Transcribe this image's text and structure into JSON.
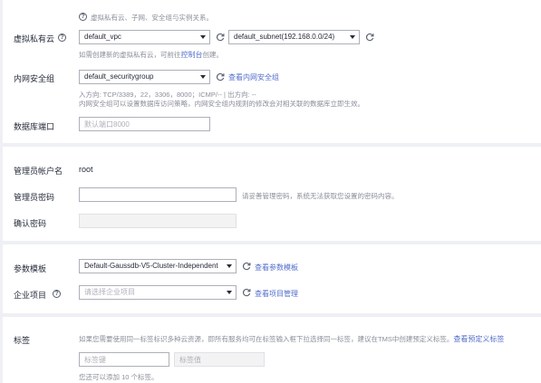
{
  "network": {
    "help_text": "虚拟私有云、子网、安全组与实例关系。",
    "vpc_label": "虚拟私有云",
    "vpc_value": "default_vpc",
    "subnet_value": "default_subnet(192.168.0.0/24)",
    "vpc_hint_prefix": "如需创建新的虚拟私有云，可前往",
    "vpc_hint_link": "控制台",
    "vpc_hint_suffix": "创建。",
    "sg_label": "内网安全组",
    "sg_value": "default_securitygroup",
    "sg_link": "查看内网安全组",
    "sg_rules_line1": "入方向: TCP/3389，22，3306，8000；ICMP/-- | 出方向: --",
    "sg_rules_line2": "内网安全组可以设置数据库访问策略，内网安全组内规则的修改会对相关联的数据库立即生效。",
    "port_label": "数据库端口",
    "port_placeholder": "默认端口8000"
  },
  "admin": {
    "user_label": "管理员帐户名",
    "user_value": "root",
    "password_label": "管理员密码",
    "password_value": "",
    "password_hint": "请妥善管理密码，系统无法获取您设置的密码内容。",
    "confirm_label": "确认密码",
    "confirm_value": ""
  },
  "params": {
    "template_label": "参数模板",
    "template_value": "Default-Gaussdb-V5-Cluster-Independent",
    "template_link": "查看参数模板",
    "project_label": "企业项目",
    "project_placeholder": "请选择企业项目",
    "project_link": "查看项目管理"
  },
  "tags": {
    "label": "标签",
    "desc": "如果您需要使用同一标签标识多种云资源，即所有服务均可在标签输入框下拉选择同一标签，建议在TMS中创建预定义标签。",
    "desc_link": "查看预定义标签",
    "key_placeholder": "标签键",
    "value_placeholder": "标签值",
    "remaining": "您还可以添加 10 个标签。"
  },
  "colors": {
    "link": "#526ecc",
    "border": "#adb0b8",
    "page_bg": "#eef0f5"
  },
  "icons": {
    "help": "question-circle-icon",
    "refresh": "refresh-icon",
    "dropdown": "chevron-down-icon"
  }
}
